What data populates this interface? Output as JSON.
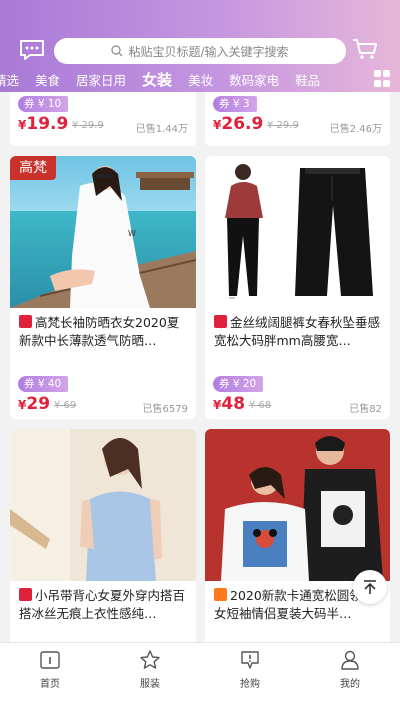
{
  "search": {
    "placeholder": "粘贴宝贝标题/输入关键字搜索"
  },
  "tabs": [
    "精选",
    "美食",
    "居家日用",
    "女装",
    "美妆",
    "数码家电",
    "鞋品"
  ],
  "active_tab": "女装",
  "colors": {
    "accent": "#b07ee0",
    "price": "#e0213b",
    "header_start": "#a87ad6",
    "header_end": "#e6b7d9"
  },
  "top_row": [
    {
      "coupon": "券 ¥ 10",
      "price_symbol": "¥",
      "price": "19.9",
      "original": "¥ 29.9",
      "sold": "已售1.44万"
    },
    {
      "coupon": "券 ¥ 3",
      "price_symbol": "¥",
      "price": "26.9",
      "original": "¥ 29.9",
      "sold": "已售2.46万"
    }
  ],
  "middle_row": [
    {
      "badge": "高梵",
      "shop_icon": "tmall",
      "title": "高梵长袖防晒衣女2020夏新款中长薄款透气防晒…",
      "coupon": "券 ¥ 40",
      "price_symbol": "¥",
      "price": "29",
      "original": "¥ 69",
      "sold": "已售6579"
    },
    {
      "shop_icon": "tmall",
      "title": "金丝绒阔腿裤女春秋坠垂感宽松大码胖mm高腰宽…",
      "coupon": "券 ¥ 20",
      "price_symbol": "¥",
      "price": "48",
      "original": "¥ 68",
      "sold": "已售82"
    }
  ],
  "bottom_row": [
    {
      "shop_icon": "tmall",
      "title": "小吊带背心女夏外穿内搭百搭冰丝无痕上衣性感纯…"
    },
    {
      "shop_icon": "taobao",
      "title": "2020新款卡通宽松圆领恤女短袖情侣夏装大码半…"
    }
  ],
  "bottom_nav": [
    {
      "label": "首页",
      "icon": "home-icon"
    },
    {
      "label": "服装",
      "icon": "star-icon"
    },
    {
      "label": "抢购",
      "icon": "flash-sale-icon"
    },
    {
      "label": "我的",
      "icon": "profile-icon"
    }
  ]
}
